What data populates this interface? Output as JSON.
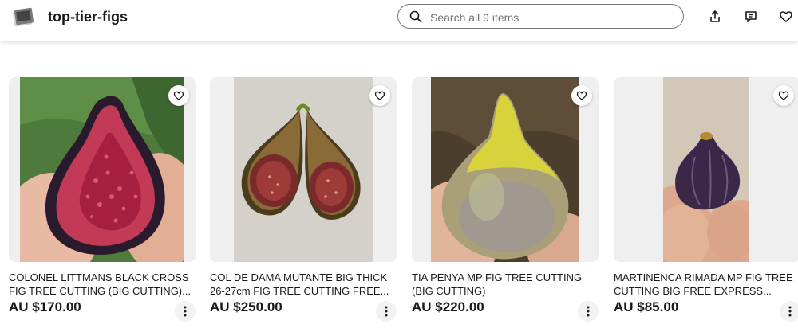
{
  "store": {
    "name": "top-tier-figs",
    "logo_icon": "store-logo-icon"
  },
  "search": {
    "placeholder": "Search all 9 items",
    "value": ""
  },
  "header_icons": [
    "share-icon",
    "message-icon",
    "heart-icon"
  ],
  "colors": {
    "text": "#191919",
    "border": "#767676",
    "image_bg": "#efefef"
  },
  "listings": [
    {
      "title": "COLONEL LITTMANS BLACK CROSS FIG TREE CUTTING (BIG CUTTING)...",
      "price": "AU $170.00"
    },
    {
      "title": "COL DE DAMA MUTANTE BIG THICK 26-27cm FIG TREE CUTTING FREE...",
      "price": "AU $250.00"
    },
    {
      "title": "TIA PENYA MP FIG TREE CUTTING (BIG CUTTING)",
      "price": "AU $220.00"
    },
    {
      "title": "MARTINENCA RIMADA MP FIG TREE CUTTING BIG FREE EXPRESS...",
      "price": "AU $85.00"
    }
  ]
}
